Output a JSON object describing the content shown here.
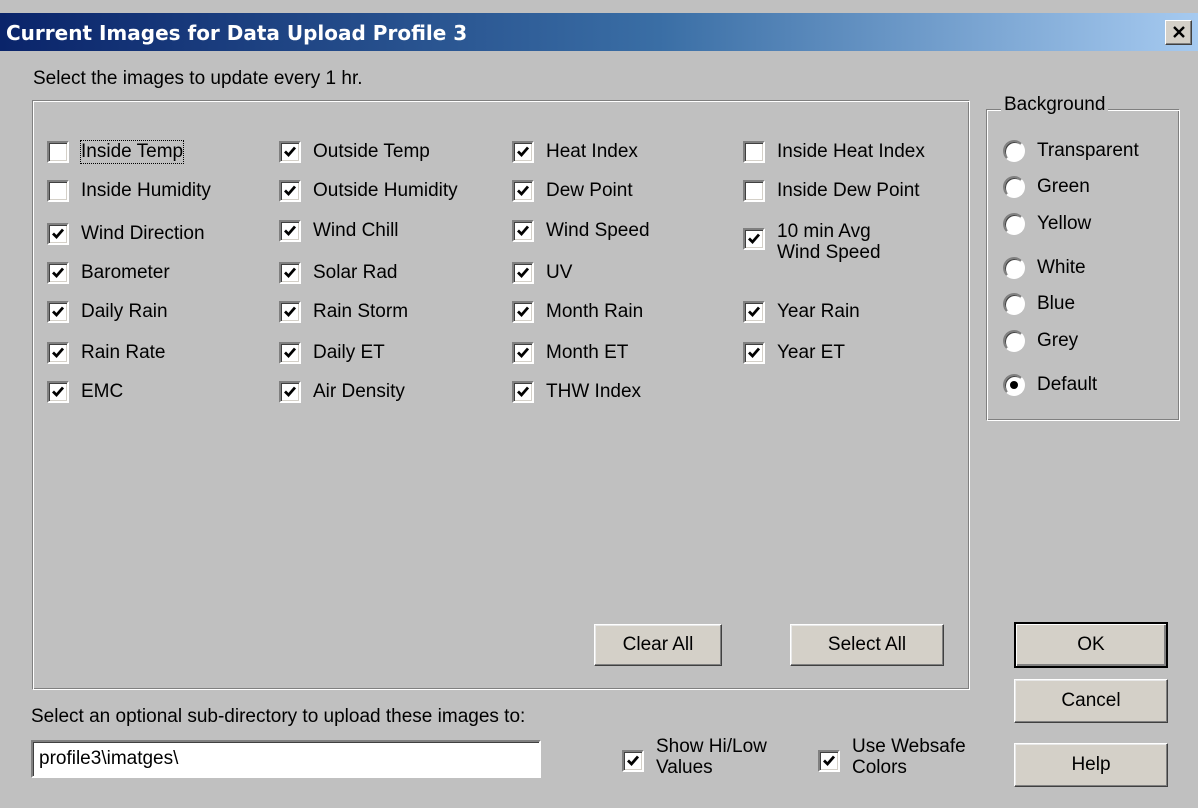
{
  "window": {
    "title": "Current Images for Data Upload Profile 3",
    "close_label": "×"
  },
  "instruction": "Select the images to update every 1 hr.",
  "images": [
    {
      "label": "Inside Temp",
      "checked": false
    },
    {
      "label": "Outside Temp",
      "checked": true
    },
    {
      "label": "Heat Index",
      "checked": true
    },
    {
      "label": "Inside Heat Index",
      "checked": false
    },
    {
      "label": "Inside Humidity",
      "checked": false
    },
    {
      "label": "Outside Humidity",
      "checked": true
    },
    {
      "label": "Dew Point",
      "checked": true
    },
    {
      "label": "Inside Dew Point",
      "checked": false
    },
    {
      "label": "Wind Direction",
      "checked": true
    },
    {
      "label": "Wind Chill",
      "checked": true
    },
    {
      "label": "Wind Speed",
      "checked": true
    },
    {
      "label": "10 min Avg",
      "label2": "Wind Speed",
      "checked": true
    },
    {
      "label": "Barometer",
      "checked": true
    },
    {
      "label": "Solar Rad",
      "checked": true
    },
    {
      "label": "UV",
      "checked": true
    },
    {
      "label": "Daily Rain",
      "checked": true
    },
    {
      "label": "Rain Storm",
      "checked": true
    },
    {
      "label": "Month Rain",
      "checked": true
    },
    {
      "label": "Year Rain",
      "checked": true
    },
    {
      "label": "Rain Rate",
      "checked": true
    },
    {
      "label": "Daily ET",
      "checked": true
    },
    {
      "label": "Month ET",
      "checked": true
    },
    {
      "label": "Year ET",
      "checked": true
    },
    {
      "label": "EMC",
      "checked": true
    },
    {
      "label": "Air Density",
      "checked": true
    },
    {
      "label": "THW Index",
      "checked": true
    }
  ],
  "background": {
    "legend": "Background",
    "options": [
      {
        "label": "Transparent",
        "selected": false
      },
      {
        "label": "Green",
        "selected": false
      },
      {
        "label": "Yellow",
        "selected": false
      },
      {
        "label": "White",
        "selected": false
      },
      {
        "label": "Blue",
        "selected": false
      },
      {
        "label": "Grey",
        "selected": false
      },
      {
        "label": "Default",
        "selected": true
      }
    ]
  },
  "buttons": {
    "clear_all": "Clear All",
    "select_all": "Select All",
    "ok": "OK",
    "cancel": "Cancel",
    "help": "Help"
  },
  "subdir": {
    "label": "Select an optional sub-directory to upload these images to:",
    "value": "profile3\\imatges\\"
  },
  "options": {
    "show_hilow": {
      "label": "Show Hi/Low",
      "label2": "Values",
      "checked": true
    },
    "websafe": {
      "label": "Use Websafe",
      "label2": "Colors",
      "checked": true
    }
  },
  "colors": {
    "title_gradient_start": "#0a246a",
    "title_gradient_end": "#a6caf0",
    "dialog_face": "#c0c0c0"
  }
}
